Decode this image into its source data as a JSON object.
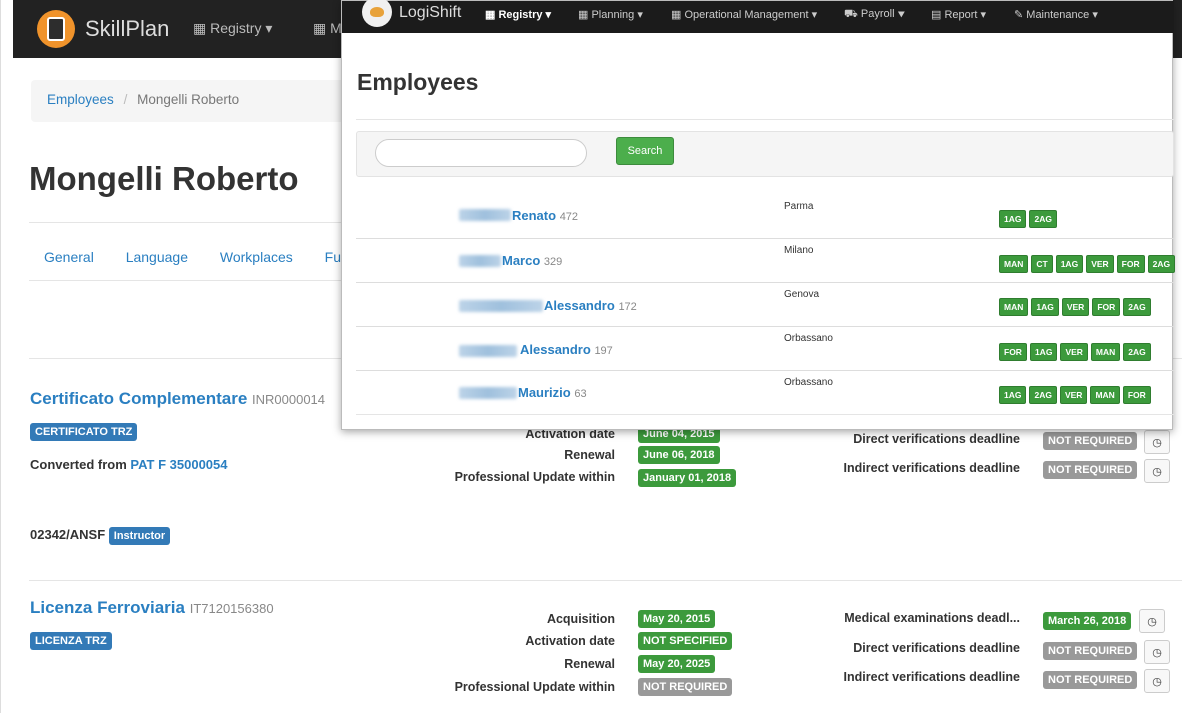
{
  "back": {
    "brand": "SkillPlan",
    "menu": [
      "Registry ▾",
      "M"
    ],
    "breadcrumb": {
      "parent": "Employees",
      "sep": "/",
      "current": "Mongelli Roberto"
    },
    "title": "Mongelli Roberto",
    "tabs": [
      "General",
      "Language",
      "Workplaces",
      "Fun"
    ],
    "cert": {
      "title": "Certificato Complementare",
      "code": "INR0000014",
      "label": "CERTIFICATO TRZ",
      "converted_prefix": "Converted from",
      "converted_link": "PAT F 35000054",
      "id_text": "02342/ANSF",
      "id_badge": "Instructor",
      "rows": [
        {
          "label": "Activation date",
          "value": "June 04, 2015"
        },
        {
          "label": "Renewal",
          "value": "June 06, 2018"
        },
        {
          "label": "Professional Update within",
          "value": "January 01, 2018"
        }
      ],
      "right_rows": [
        {
          "label": "Direct verifications deadline",
          "value": "NOT REQUIRED"
        },
        {
          "label": "Indirect verifications deadline",
          "value": "NOT REQUIRED"
        }
      ]
    },
    "licence": {
      "title": "Licenza Ferroviaria",
      "code": "IT7120156380",
      "label": "LICENZA TRZ",
      "rows": [
        {
          "label": "Acquisition",
          "value": "May 20, 2015",
          "color": "green"
        },
        {
          "label": "Activation date",
          "value": "NOT SPECIFIED",
          "color": "green"
        },
        {
          "label": "Renewal",
          "value": "May 20, 2025",
          "color": "green"
        },
        {
          "label": "Professional Update within",
          "value": "NOT REQUIRED",
          "color": "grey"
        }
      ],
      "right_rows": [
        {
          "label": "Medical examinations deadl...",
          "value": "March 26, 2018",
          "color": "green"
        },
        {
          "label": "Direct verifications deadline",
          "value": "NOT REQUIRED",
          "color": "grey"
        },
        {
          "label": "Indirect verifications deadline",
          "value": "NOT REQUIRED",
          "color": "grey"
        }
      ]
    }
  },
  "front": {
    "brand": "LogiShift",
    "menu": [
      {
        "label": "Registry ▾",
        "active": true
      },
      {
        "label": "Planning ▾",
        "active": false
      },
      {
        "label": "Operational Management ▾",
        "active": false
      },
      {
        "label": "Payroll ▾",
        "active": false
      },
      {
        "label": "Report ▾",
        "active": false
      },
      {
        "label": "Maintenance ▾",
        "active": false
      }
    ],
    "title": "Employees",
    "search_placeholder": "",
    "search_button": "Search",
    "employees": [
      {
        "name": "Renato",
        "id": "472",
        "city": "Parma",
        "tags": [
          "1AG",
          "2AG"
        ]
      },
      {
        "name": "Marco",
        "id": "329",
        "city": "Milano",
        "tags": [
          "MAN",
          "CT",
          "1AG",
          "VER",
          "FOR",
          "2AG"
        ]
      },
      {
        "name": "Alessandro",
        "id": "172",
        "city": "Genova",
        "tags": [
          "MAN",
          "1AG",
          "VER",
          "FOR",
          "2AG"
        ]
      },
      {
        "name": "Alessandro",
        "id": "197",
        "city": "Orbassano",
        "tags": [
          "FOR",
          "1AG",
          "VER",
          "MAN",
          "2AG"
        ]
      },
      {
        "name": "Maurizio",
        "id": "63",
        "city": "Orbassano",
        "tags": [
          "1AG",
          "2AG",
          "VER",
          "MAN",
          "FOR"
        ]
      }
    ]
  },
  "colors": {
    "brand_blue": "#2a7fc1",
    "success": "#3c9a3c",
    "label_blue": "#337ab7",
    "grey_badge": "#999999",
    "nav_dark": "#1b1b1b"
  }
}
